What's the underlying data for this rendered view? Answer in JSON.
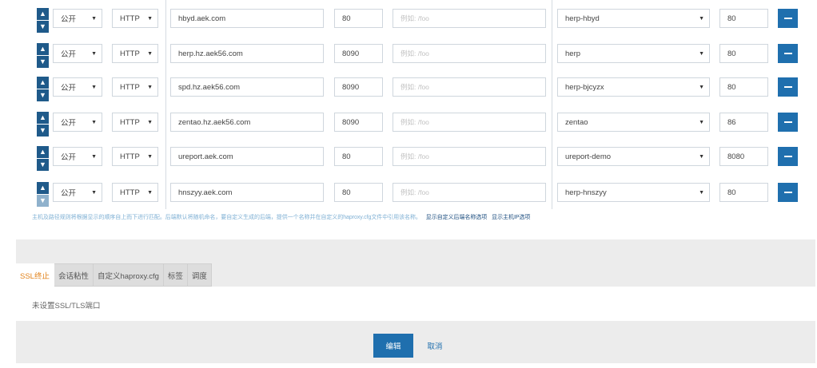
{
  "rows": [
    {
      "access": "公开",
      "protocol": "HTTP",
      "domain": "hbyd.aek.com",
      "port": "80",
      "path_placeholder": "例如: /foo",
      "service": "herp-hbyd",
      "target_port": "80"
    },
    {
      "access": "公开",
      "protocol": "HTTP",
      "domain": "herp.hz.aek56.com",
      "port": "8090",
      "path_placeholder": "例如: /foo",
      "service": "herp",
      "target_port": "80"
    },
    {
      "access": "公开",
      "protocol": "HTTP",
      "domain": "spd.hz.aek56.com",
      "port": "8090",
      "path_placeholder": "例如: /foo",
      "service": "herp-bjcyzx",
      "target_port": "80"
    },
    {
      "access": "公开",
      "protocol": "HTTP",
      "domain": "zentao.hz.aek56.com",
      "port": "8090",
      "path_placeholder": "例如: /foo",
      "service": "zentao",
      "target_port": "86"
    },
    {
      "access": "公开",
      "protocol": "HTTP",
      "domain": "ureport.aek.com",
      "port": "80",
      "path_placeholder": "例如: /foo",
      "service": "ureport-demo",
      "target_port": "8080"
    },
    {
      "access": "公开",
      "protocol": "HTTP",
      "domain": "hnszyy.aek.com",
      "port": "80",
      "path_placeholder": "例如: /foo",
      "service": "herp-hnszyy",
      "target_port": "80"
    }
  ],
  "hint": {
    "text": "主机及路径规则将根据显示的顺序自上而下进行匹配。后端默认将随机命名，要自定义生成的后端，提供一个名称并在自定义的haproxy.cfg文件中引用该名称。",
    "link1": "显示自定义后端名称选项",
    "link2": "显示主机IP选项"
  },
  "tabs": [
    "SSL终止",
    "会话粘性",
    "自定义haproxy.cfg",
    "标签",
    "调度"
  ],
  "tab_message": "未设置SSL/TLS端口",
  "buttons": {
    "edit": "编辑",
    "cancel": "取消"
  },
  "colors": {
    "primary": "#1f6fae",
    "active_tab": "#e2821a",
    "hint": "#7fb0d4"
  }
}
